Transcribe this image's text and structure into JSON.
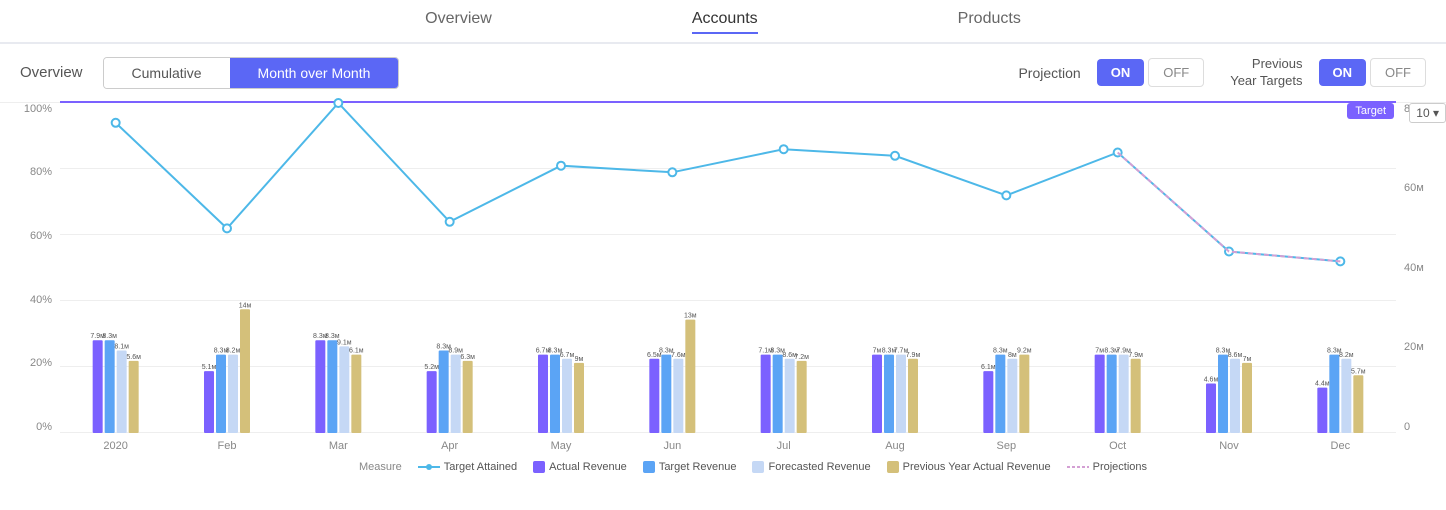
{
  "nav": {
    "items": [
      {
        "id": "overview",
        "label": "Overview",
        "active": false
      },
      {
        "id": "accounts",
        "label": "Accounts",
        "active": true
      },
      {
        "id": "products",
        "label": "Products",
        "active": false
      }
    ]
  },
  "toolbar": {
    "overview_label": "Overview",
    "cumulative_label": "Cumulative",
    "month_over_month_label": "Month over Month",
    "projection_label": "Projection",
    "on_label": "ON",
    "off_label": "OFF",
    "prev_year_label": "Previous\nYear Targets",
    "on2_label": "ON",
    "off2_label": "OFF",
    "dropdown_label": "10 ▾"
  },
  "chart": {
    "target_label": "Target",
    "y_left_ticks": [
      "0%",
      "20%",
      "40%",
      "60%",
      "80%",
      "100%"
    ],
    "y_right_ticks": [
      "0",
      "20м",
      "40м",
      "60м",
      "80м"
    ],
    "months": [
      "2020",
      "Feb",
      "Mar",
      "Apr",
      "May",
      "Jun",
      "Jul",
      "Aug",
      "Sep",
      "Oct",
      "Nov",
      "Dec"
    ],
    "line_points": [
      94,
      62,
      100,
      64,
      81,
      79,
      86,
      84,
      72,
      85,
      55,
      52
    ],
    "bars": [
      {
        "month": "2020",
        "actual": 45,
        "target": 45,
        "forecast": 40,
        "prev": 35,
        "vals": [
          "7.9м",
          "8.3м",
          "8.1м",
          "5.6м"
        ]
      },
      {
        "month": "Feb",
        "actual": 30,
        "target": 38,
        "forecast": 38,
        "prev": 60,
        "vals": [
          "5.1м",
          "8.3м",
          "8.2м",
          "14м"
        ]
      },
      {
        "month": "Mar",
        "actual": 45,
        "target": 45,
        "forecast": 42,
        "prev": 38,
        "vals": [
          "8.3м",
          "8.3м",
          "9.1м",
          "6.1м"
        ]
      },
      {
        "month": "Apr",
        "actual": 30,
        "target": 40,
        "forecast": 38,
        "prev": 35,
        "vals": [
          "5.2м",
          "8.3м",
          "8.9м",
          "6.3м"
        ]
      },
      {
        "month": "May",
        "actual": 38,
        "target": 38,
        "forecast": 36,
        "prev": 34,
        "vals": [
          "6.7м",
          "8.3м",
          "6.7м",
          "9м"
        ]
      },
      {
        "month": "Jun",
        "actual": 36,
        "target": 38,
        "forecast": 36,
        "prev": 55,
        "vals": [
          "6.5м",
          "8.3м",
          "7.6м",
          "13м"
        ]
      },
      {
        "month": "Jul",
        "actual": 38,
        "target": 38,
        "forecast": 36,
        "prev": 35,
        "vals": [
          "7.1м",
          "8.3м",
          "8.6м",
          "7.2м"
        ]
      },
      {
        "month": "Aug",
        "actual": 38,
        "target": 38,
        "forecast": 38,
        "prev": 36,
        "vals": [
          "7м",
          "8.3м",
          "7.7м",
          "7.9м"
        ]
      },
      {
        "month": "Sep",
        "actual": 30,
        "target": 38,
        "forecast": 36,
        "prev": 38,
        "vals": [
          "6.1м",
          "8.3м",
          "8м",
          "9.2м"
        ]
      },
      {
        "month": "Oct",
        "actual": 38,
        "target": 38,
        "forecast": 38,
        "prev": 36,
        "vals": [
          "7м",
          "8.3м",
          "7.9м",
          "7.9м"
        ]
      },
      {
        "month": "Nov",
        "actual": 24,
        "target": 38,
        "forecast": 36,
        "prev": 34,
        "vals": [
          "4.6м",
          "8.3м",
          "8.6м",
          "7м"
        ]
      },
      {
        "month": "Dec",
        "actual": 22,
        "target": 38,
        "forecast": 36,
        "prev": 28,
        "vals": [
          "4.4м",
          "8.3м",
          "8.2м",
          "5.7м"
        ]
      }
    ],
    "legend": {
      "measure": "Measure",
      "target_attained": "Target Attained",
      "actual_revenue": "Actual Revenue",
      "target_revenue": "Target Revenue",
      "forecasted_revenue": "Forecasted Revenue",
      "prev_year": "Previous Year Actual Revenue",
      "projections": "Projections"
    },
    "colors": {
      "actual": "#7b61ff",
      "target": "#5ba4f5",
      "forecast": "#c5d8f5",
      "prev_year": "#d4c07a",
      "line": "#4db8e8",
      "projection_line": "#d4a0d4",
      "target_line": "#7b61ff"
    }
  }
}
